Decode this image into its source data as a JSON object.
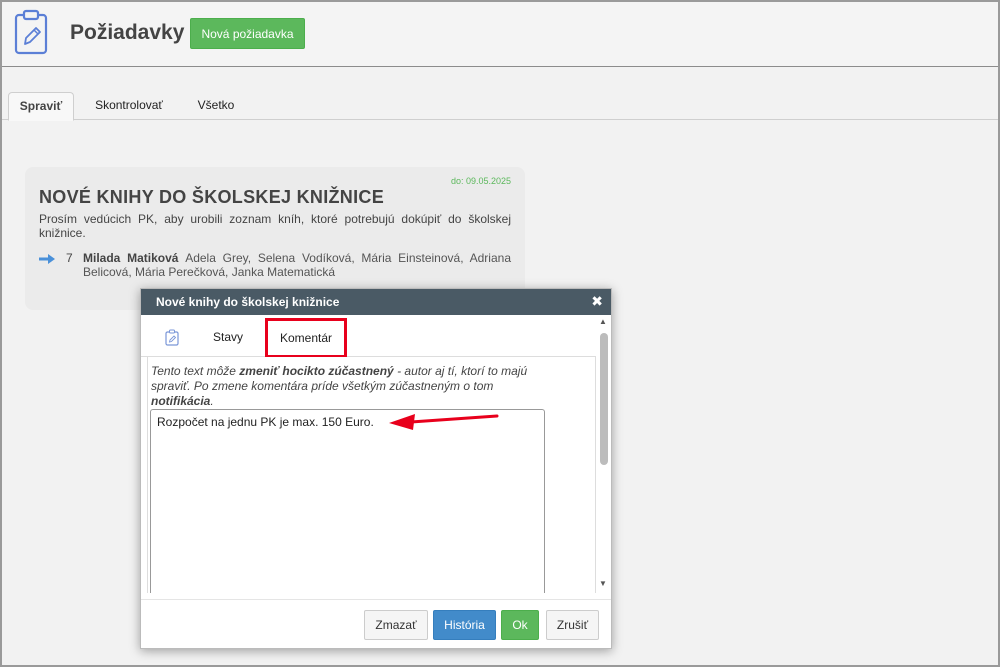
{
  "header": {
    "title": "Požiadavky",
    "new_button": "Nová požiadavka",
    "icon": "clipboard-edit-icon"
  },
  "tabs": [
    {
      "label": "Spraviť",
      "active": true
    },
    {
      "label": "Skontrolovať",
      "active": false
    },
    {
      "label": "Všetko",
      "active": false
    }
  ],
  "card": {
    "due": "do: 09.05.2025",
    "title": "NOVÉ KNIHY DO ŠKOLSKEJ KNIŽNICE",
    "description": "Prosím vedúcich PK, aby urobili zoznam kníh, ktoré potrebujú dokúpiť do školskej knižnice.",
    "count": "7",
    "owner": "Milada Matiková",
    "participants": "Adela Grey, Selena Vodíková, Mária Einsteinová, Adriana Belicová, Mária Perečková, Janka Matematická"
  },
  "modal": {
    "title": "Nové knihy do školskej knižnice",
    "tabs": [
      "Stavy",
      "Komentár"
    ],
    "info_prefix": "Tento text môže ",
    "info_bold1": "zmeniť hocikto zúčastnený",
    "info_middle": " - autor aj tí, ktorí to majú spraviť. Po zmene komentára príde všetkým zúčastneným o tom ",
    "info_bold2": "notifikácia",
    "info_suffix": ".",
    "comment": "Rozpočet na jednu PK je max. 150 Euro.",
    "buttons": {
      "delete": "Zmazať",
      "history": "História",
      "ok": "Ok",
      "cancel": "Zrušiť"
    }
  },
  "colors": {
    "green": "#5cb85c",
    "blue": "#428bca",
    "modal_header": "#4a5a65",
    "highlight_red": "#e8001c",
    "arrow_blue": "#4a90d9"
  }
}
